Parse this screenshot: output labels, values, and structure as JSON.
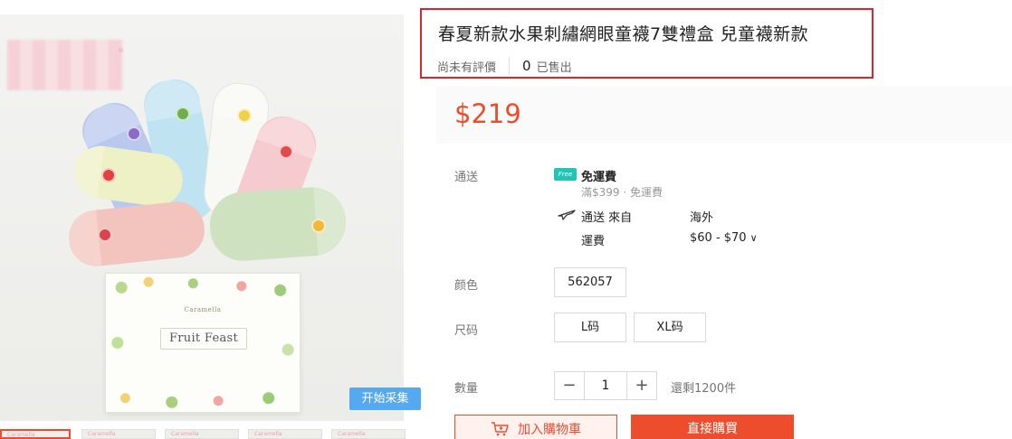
{
  "product": {
    "title": "春夏新款水果刺繡網眼童襪7雙禮盒 兒童襪新款",
    "rating_text": "尚未有評價",
    "sold_count": "0",
    "sold_label": "已售出",
    "price": "$219"
  },
  "gallery": {
    "collect_button": "开始采集",
    "box_brand": "Caramella",
    "box_title": "Fruit Feast",
    "thumb_brand": "Caramella"
  },
  "shipping": {
    "label": "通送",
    "free_title": "免運費",
    "free_badge": "Free",
    "free_condition": "滿$399 · 免運費",
    "from_label": "通送 來自",
    "from_value": "海外",
    "fee_label": "運費",
    "fee_value": "$60 - $70"
  },
  "color": {
    "label": "颜色",
    "options": [
      "562057"
    ]
  },
  "size": {
    "label": "尺码",
    "options": [
      "L码",
      "XL码"
    ]
  },
  "quantity": {
    "label": "數量",
    "value": "1",
    "minus": "−",
    "plus": "+",
    "stock": "還剩1200件"
  },
  "actions": {
    "add_to_cart": "加入購物車",
    "buy_now": "直接購買"
  },
  "colors": {
    "accent": "#ee4d2d",
    "highlight_border": "#d9252f",
    "collect_button": "#55a9f0",
    "free_badge": "#22c4b5"
  }
}
